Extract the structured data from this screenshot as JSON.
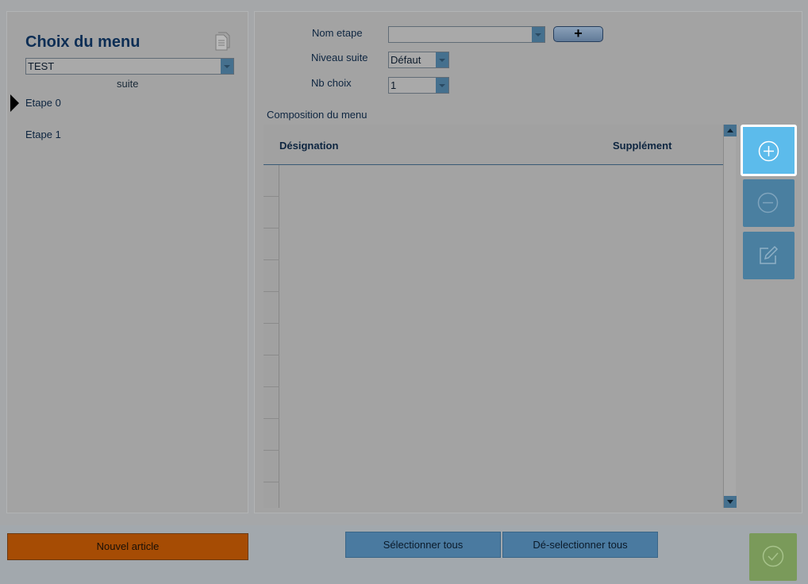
{
  "left_panel": {
    "title": "Choix du menu",
    "menu_select_value": "TEST",
    "suite_label": "suite",
    "steps": [
      {
        "label": "Etape 0",
        "selected": true
      },
      {
        "label": "Etape 1",
        "selected": false
      }
    ]
  },
  "form": {
    "nom_etape_label": "Nom etape",
    "nom_etape_value": "",
    "add_step_label": "+",
    "niveau_suite_label": "Niveau suite",
    "niveau_suite_value": "Défaut",
    "nb_choix_label": "Nb choix",
    "nb_choix_value": "1"
  },
  "composition": {
    "label": "Composition du menu",
    "columns": [
      "Désignation",
      "Supplément"
    ],
    "rows": []
  },
  "actions": {
    "add_icon": "plus-circle-icon",
    "remove_icon": "minus-circle-icon",
    "edit_icon": "edit-icon"
  },
  "bottom_bar": {
    "new_article_label": "Nouvel article",
    "select_all_label": "Sélectionner tous",
    "deselect_all_label": "Dé-selectionner tous",
    "validate_icon": "check-circle-icon"
  },
  "colors": {
    "accent_add": "#5cbbeb",
    "accent_blue": "#4a7aa0",
    "new_article": "#a64c04",
    "validate": "#7a9a5a"
  }
}
